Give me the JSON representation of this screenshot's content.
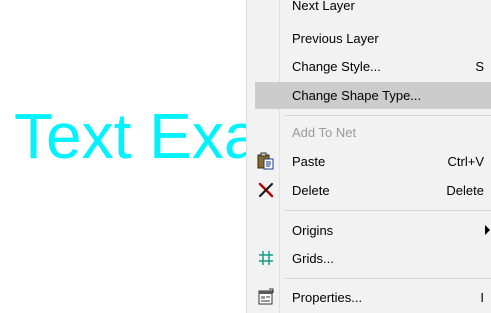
{
  "canvas": {
    "text": "Text Exa",
    "color": "#00f3ff"
  },
  "menu": {
    "items": [
      {
        "label": "Next Layer",
        "shortcut": ""
      },
      {
        "label": "Previous Layer",
        "shortcut": ""
      },
      {
        "label": "Change Style...",
        "shortcut": "S"
      },
      {
        "label": "Change Shape Type...",
        "shortcut": ""
      },
      {
        "label": "Add To Net",
        "shortcut": ""
      },
      {
        "label": "Paste",
        "shortcut": "Ctrl+V",
        "icon": "paste-icon"
      },
      {
        "label": "Delete",
        "shortcut": "Delete",
        "icon": "delete-icon"
      },
      {
        "label": "Origins",
        "shortcut": ""
      },
      {
        "label": "Grids...",
        "shortcut": "",
        "icon": "grid-icon"
      },
      {
        "label": "Properties...",
        "shortcut": "I",
        "icon": "properties-icon"
      }
    ],
    "highlight_color": "#cccccc",
    "disabled_color": "#9b9b9b"
  }
}
